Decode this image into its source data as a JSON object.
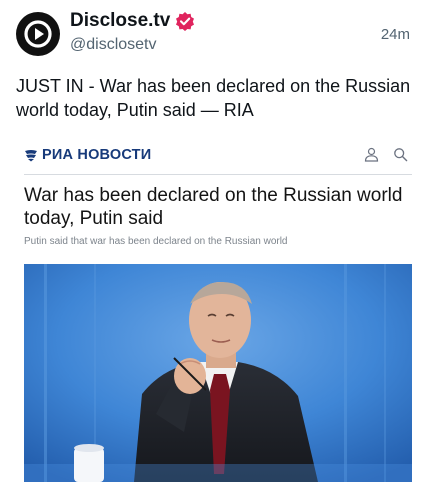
{
  "tweet": {
    "author_name": "Disclose.tv",
    "handle": "@disclosetv",
    "timestamp": "24m",
    "text": "JUST IN - War has been declared on the Russian world today, Putin said — RIA"
  },
  "card": {
    "source_name": "РИА НОВОСТИ",
    "headline": "War has been declared on the Russian world today, Putin said",
    "subheadline": "Putin said that war has been declared on the Russian world"
  },
  "colors": {
    "verified_badge": "#e0245e",
    "ria_brand": "#173a7a",
    "photo_background": "#3f86d6"
  },
  "icons": {
    "avatar": "disclose-logo-icon",
    "verified": "verified-badge-icon",
    "account": "user-icon",
    "search": "search-icon"
  }
}
